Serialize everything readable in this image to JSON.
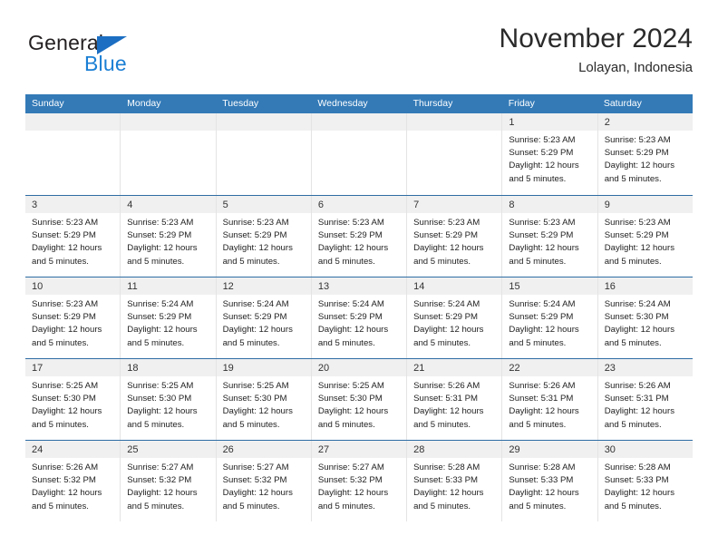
{
  "brand": {
    "name_part1": "General",
    "name_part2": "Blue",
    "triangle_color": "#1b6ec2",
    "blue_color": "#1b7fd4"
  },
  "header": {
    "title": "November 2024",
    "subtitle": "Lolayan, Indonesia"
  },
  "theme": {
    "header_row_bg": "#337ab7",
    "header_row_text": "#ffffff",
    "row_divider": "#2e6da4",
    "day_band_bg": "#f0f0f0"
  },
  "weekdays": [
    "Sunday",
    "Monday",
    "Tuesday",
    "Wednesday",
    "Thursday",
    "Friday",
    "Saturday"
  ],
  "weeks": [
    [
      {
        "day": "",
        "sunrise": "",
        "sunset": "",
        "daylight": "",
        "daylight2": "",
        "empty": true
      },
      {
        "day": "",
        "sunrise": "",
        "sunset": "",
        "daylight": "",
        "daylight2": "",
        "empty": true
      },
      {
        "day": "",
        "sunrise": "",
        "sunset": "",
        "daylight": "",
        "daylight2": "",
        "empty": true
      },
      {
        "day": "",
        "sunrise": "",
        "sunset": "",
        "daylight": "",
        "daylight2": "",
        "empty": true
      },
      {
        "day": "",
        "sunrise": "",
        "sunset": "",
        "daylight": "",
        "daylight2": "",
        "empty": true
      },
      {
        "day": "1",
        "sunrise": "Sunrise: 5:23 AM",
        "sunset": "Sunset: 5:29 PM",
        "daylight": "Daylight: 12 hours",
        "daylight2": "and 5 minutes.",
        "empty": false
      },
      {
        "day": "2",
        "sunrise": "Sunrise: 5:23 AM",
        "sunset": "Sunset: 5:29 PM",
        "daylight": "Daylight: 12 hours",
        "daylight2": "and 5 minutes.",
        "empty": false
      }
    ],
    [
      {
        "day": "3",
        "sunrise": "Sunrise: 5:23 AM",
        "sunset": "Sunset: 5:29 PM",
        "daylight": "Daylight: 12 hours",
        "daylight2": "and 5 minutes.",
        "empty": false
      },
      {
        "day": "4",
        "sunrise": "Sunrise: 5:23 AM",
        "sunset": "Sunset: 5:29 PM",
        "daylight": "Daylight: 12 hours",
        "daylight2": "and 5 minutes.",
        "empty": false
      },
      {
        "day": "5",
        "sunrise": "Sunrise: 5:23 AM",
        "sunset": "Sunset: 5:29 PM",
        "daylight": "Daylight: 12 hours",
        "daylight2": "and 5 minutes.",
        "empty": false
      },
      {
        "day": "6",
        "sunrise": "Sunrise: 5:23 AM",
        "sunset": "Sunset: 5:29 PM",
        "daylight": "Daylight: 12 hours",
        "daylight2": "and 5 minutes.",
        "empty": false
      },
      {
        "day": "7",
        "sunrise": "Sunrise: 5:23 AM",
        "sunset": "Sunset: 5:29 PM",
        "daylight": "Daylight: 12 hours",
        "daylight2": "and 5 minutes.",
        "empty": false
      },
      {
        "day": "8",
        "sunrise": "Sunrise: 5:23 AM",
        "sunset": "Sunset: 5:29 PM",
        "daylight": "Daylight: 12 hours",
        "daylight2": "and 5 minutes.",
        "empty": false
      },
      {
        "day": "9",
        "sunrise": "Sunrise: 5:23 AM",
        "sunset": "Sunset: 5:29 PM",
        "daylight": "Daylight: 12 hours",
        "daylight2": "and 5 minutes.",
        "empty": false
      }
    ],
    [
      {
        "day": "10",
        "sunrise": "Sunrise: 5:23 AM",
        "sunset": "Sunset: 5:29 PM",
        "daylight": "Daylight: 12 hours",
        "daylight2": "and 5 minutes.",
        "empty": false
      },
      {
        "day": "11",
        "sunrise": "Sunrise: 5:24 AM",
        "sunset": "Sunset: 5:29 PM",
        "daylight": "Daylight: 12 hours",
        "daylight2": "and 5 minutes.",
        "empty": false
      },
      {
        "day": "12",
        "sunrise": "Sunrise: 5:24 AM",
        "sunset": "Sunset: 5:29 PM",
        "daylight": "Daylight: 12 hours",
        "daylight2": "and 5 minutes.",
        "empty": false
      },
      {
        "day": "13",
        "sunrise": "Sunrise: 5:24 AM",
        "sunset": "Sunset: 5:29 PM",
        "daylight": "Daylight: 12 hours",
        "daylight2": "and 5 minutes.",
        "empty": false
      },
      {
        "day": "14",
        "sunrise": "Sunrise: 5:24 AM",
        "sunset": "Sunset: 5:29 PM",
        "daylight": "Daylight: 12 hours",
        "daylight2": "and 5 minutes.",
        "empty": false
      },
      {
        "day": "15",
        "sunrise": "Sunrise: 5:24 AM",
        "sunset": "Sunset: 5:29 PM",
        "daylight": "Daylight: 12 hours",
        "daylight2": "and 5 minutes.",
        "empty": false
      },
      {
        "day": "16",
        "sunrise": "Sunrise: 5:24 AM",
        "sunset": "Sunset: 5:30 PM",
        "daylight": "Daylight: 12 hours",
        "daylight2": "and 5 minutes.",
        "empty": false
      }
    ],
    [
      {
        "day": "17",
        "sunrise": "Sunrise: 5:25 AM",
        "sunset": "Sunset: 5:30 PM",
        "daylight": "Daylight: 12 hours",
        "daylight2": "and 5 minutes.",
        "empty": false
      },
      {
        "day": "18",
        "sunrise": "Sunrise: 5:25 AM",
        "sunset": "Sunset: 5:30 PM",
        "daylight": "Daylight: 12 hours",
        "daylight2": "and 5 minutes.",
        "empty": false
      },
      {
        "day": "19",
        "sunrise": "Sunrise: 5:25 AM",
        "sunset": "Sunset: 5:30 PM",
        "daylight": "Daylight: 12 hours",
        "daylight2": "and 5 minutes.",
        "empty": false
      },
      {
        "day": "20",
        "sunrise": "Sunrise: 5:25 AM",
        "sunset": "Sunset: 5:30 PM",
        "daylight": "Daylight: 12 hours",
        "daylight2": "and 5 minutes.",
        "empty": false
      },
      {
        "day": "21",
        "sunrise": "Sunrise: 5:26 AM",
        "sunset": "Sunset: 5:31 PM",
        "daylight": "Daylight: 12 hours",
        "daylight2": "and 5 minutes.",
        "empty": false
      },
      {
        "day": "22",
        "sunrise": "Sunrise: 5:26 AM",
        "sunset": "Sunset: 5:31 PM",
        "daylight": "Daylight: 12 hours",
        "daylight2": "and 5 minutes.",
        "empty": false
      },
      {
        "day": "23",
        "sunrise": "Sunrise: 5:26 AM",
        "sunset": "Sunset: 5:31 PM",
        "daylight": "Daylight: 12 hours",
        "daylight2": "and 5 minutes.",
        "empty": false
      }
    ],
    [
      {
        "day": "24",
        "sunrise": "Sunrise: 5:26 AM",
        "sunset": "Sunset: 5:32 PM",
        "daylight": "Daylight: 12 hours",
        "daylight2": "and 5 minutes.",
        "empty": false
      },
      {
        "day": "25",
        "sunrise": "Sunrise: 5:27 AM",
        "sunset": "Sunset: 5:32 PM",
        "daylight": "Daylight: 12 hours",
        "daylight2": "and 5 minutes.",
        "empty": false
      },
      {
        "day": "26",
        "sunrise": "Sunrise: 5:27 AM",
        "sunset": "Sunset: 5:32 PM",
        "daylight": "Daylight: 12 hours",
        "daylight2": "and 5 minutes.",
        "empty": false
      },
      {
        "day": "27",
        "sunrise": "Sunrise: 5:27 AM",
        "sunset": "Sunset: 5:32 PM",
        "daylight": "Daylight: 12 hours",
        "daylight2": "and 5 minutes.",
        "empty": false
      },
      {
        "day": "28",
        "sunrise": "Sunrise: 5:28 AM",
        "sunset": "Sunset: 5:33 PM",
        "daylight": "Daylight: 12 hours",
        "daylight2": "and 5 minutes.",
        "empty": false
      },
      {
        "day": "29",
        "sunrise": "Sunrise: 5:28 AM",
        "sunset": "Sunset: 5:33 PM",
        "daylight": "Daylight: 12 hours",
        "daylight2": "and 5 minutes.",
        "empty": false
      },
      {
        "day": "30",
        "sunrise": "Sunrise: 5:28 AM",
        "sunset": "Sunset: 5:33 PM",
        "daylight": "Daylight: 12 hours",
        "daylight2": "and 5 minutes.",
        "empty": false
      }
    ]
  ]
}
